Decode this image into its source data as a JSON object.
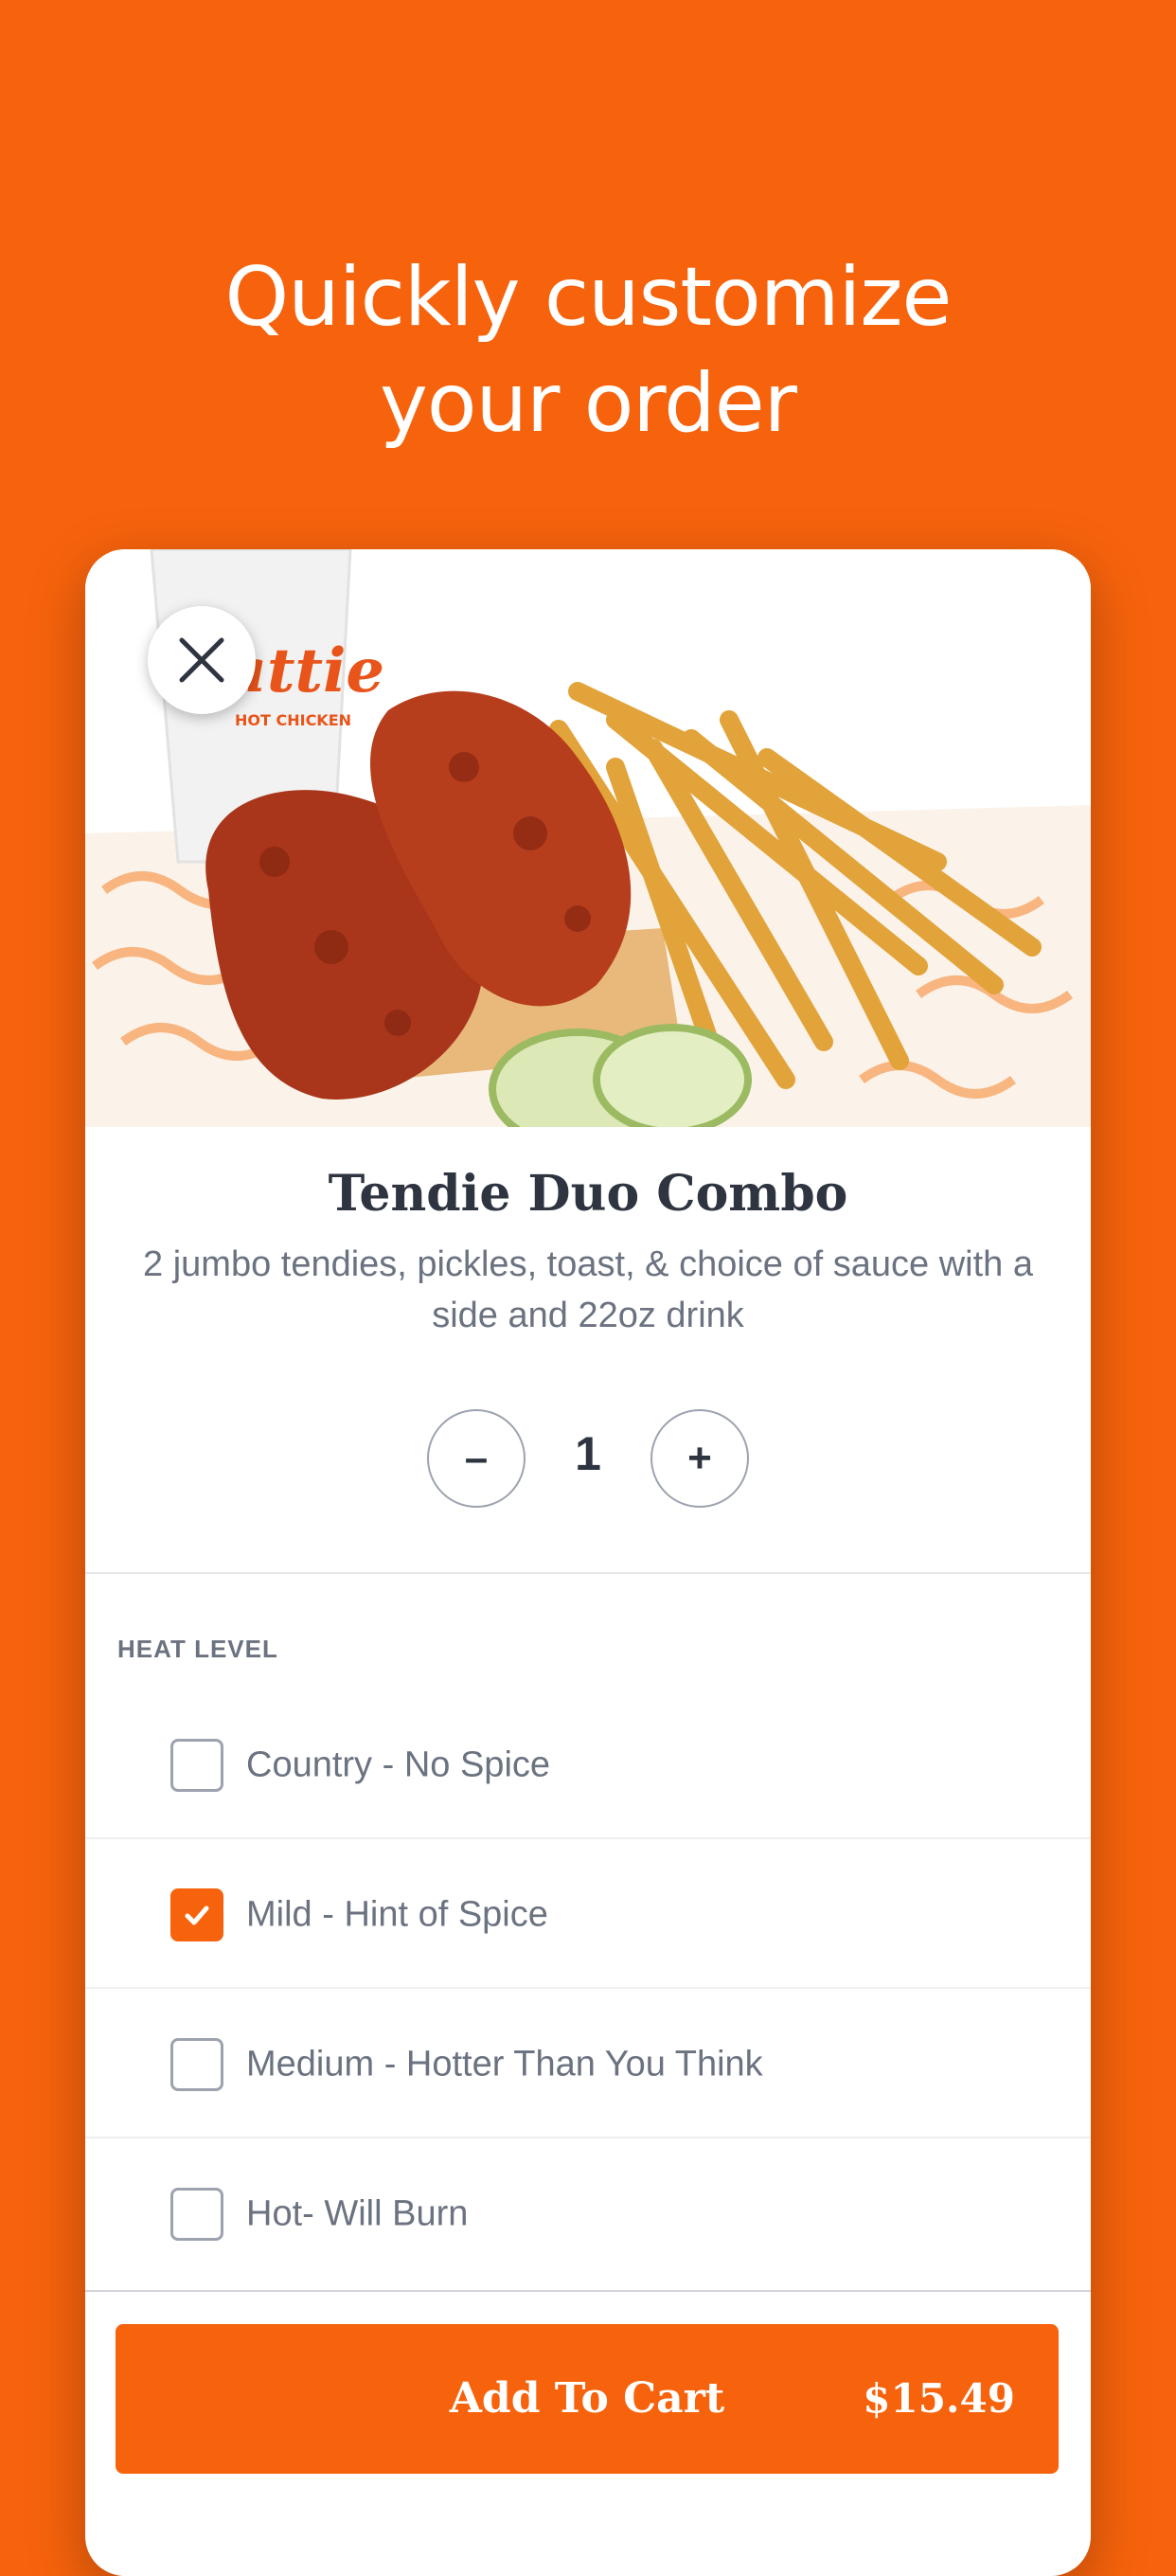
{
  "colors": {
    "background": "#F7630C",
    "accent": "#F7630C",
    "text_dark": "#2E3440",
    "text_muted": "#6B7280"
  },
  "headline": {
    "line1": "Quickly customize",
    "line2": "your order"
  },
  "hero": {
    "brand_text": "Hattie",
    "brand_sub": "HOT CHICKEN",
    "close_icon": "close-icon"
  },
  "product": {
    "title": "Tendie Duo Combo",
    "description": "2 jumbo tendies, pickles, toast, & choice of sauce with a side and 22oz drink"
  },
  "quantity": {
    "minus_label": "–",
    "value": "1",
    "plus_label": "+"
  },
  "heat_level": {
    "label": "HEAT LEVEL",
    "options": [
      {
        "label": "Country - No Spice",
        "checked": false
      },
      {
        "label": "Mild - Hint of Spice",
        "checked": true
      },
      {
        "label": "Medium - Hotter Than You Think",
        "checked": false
      },
      {
        "label": "Hot- Will Burn",
        "checked": false
      }
    ]
  },
  "cart": {
    "label": "Add To Cart",
    "price": "$15.49"
  }
}
